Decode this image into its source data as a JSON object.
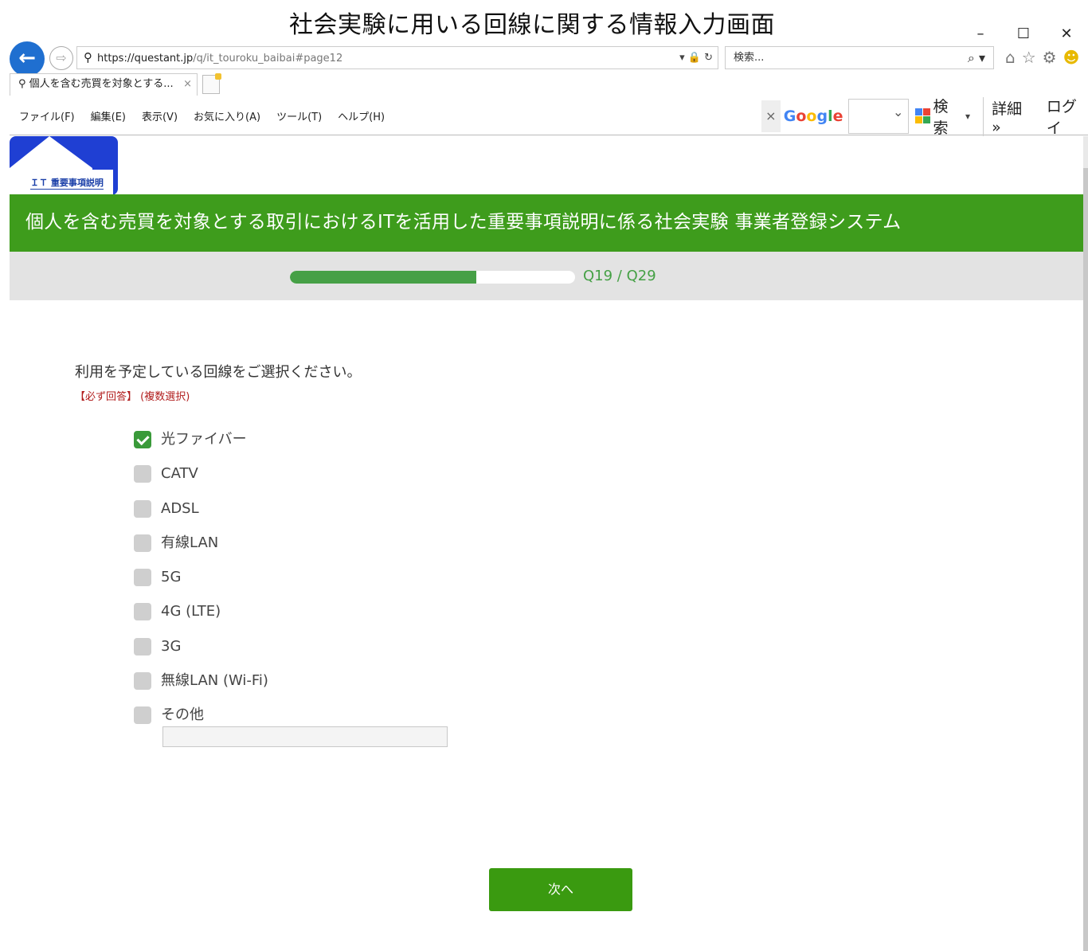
{
  "caption": "社会実験に用いる回線に関する情報入力画面",
  "window": {
    "minimize": "–",
    "maximize": "☐",
    "close": "✕"
  },
  "browser": {
    "url_host": "https://questant.jp",
    "url_path": "/q/it_touroku_baibai#page12",
    "url_tools": "▾ 🔒 ↻",
    "search_placeholder": "検索...",
    "tab_title": "個人を含む売買を対象とする...",
    "tab_close": "×",
    "menus": [
      "ファイル(F)",
      "編集(E)",
      "表示(V)",
      "お気に入り(A)",
      "ツール(T)",
      "ヘルプ(H)"
    ],
    "google_close": "×",
    "google_logo": [
      "G",
      "o",
      "o",
      "g",
      "l",
      "e"
    ],
    "google_search": "検索",
    "google_detail": "詳細 »",
    "google_login": "ログイ"
  },
  "logo_text": "ＩＴ 重要事項説明",
  "banner_title": "個人を含む売買を対象とする取引におけるITを活用した重要事項説明に係る社会実験 事業者登録システム",
  "progress": {
    "label": "Q19 / Q29",
    "current": 19,
    "total": 29,
    "fill_fraction": 0.655
  },
  "question": {
    "text": "利用を予定している回線をご選択ください。",
    "required": "【必ず回答】",
    "multi": "(複数選択)",
    "options": [
      {
        "label": "光ファイバー",
        "checked": true
      },
      {
        "label": "CATV",
        "checked": false
      },
      {
        "label": "ADSL",
        "checked": false
      },
      {
        "label": "有線LAN",
        "checked": false
      },
      {
        "label": "5G",
        "checked": false
      },
      {
        "label": "4G (LTE)",
        "checked": false
      },
      {
        "label": "3G",
        "checked": false
      },
      {
        "label": "無線LAN (Wi-Fi)",
        "checked": false
      },
      {
        "label": "その他",
        "checked": false
      }
    ],
    "other_value": ""
  },
  "next_button": "次へ",
  "colors": {
    "banner": "#3e9c1c",
    "progress": "#46a046",
    "accent": "#3a9a10",
    "required": "#b11d1d"
  }
}
